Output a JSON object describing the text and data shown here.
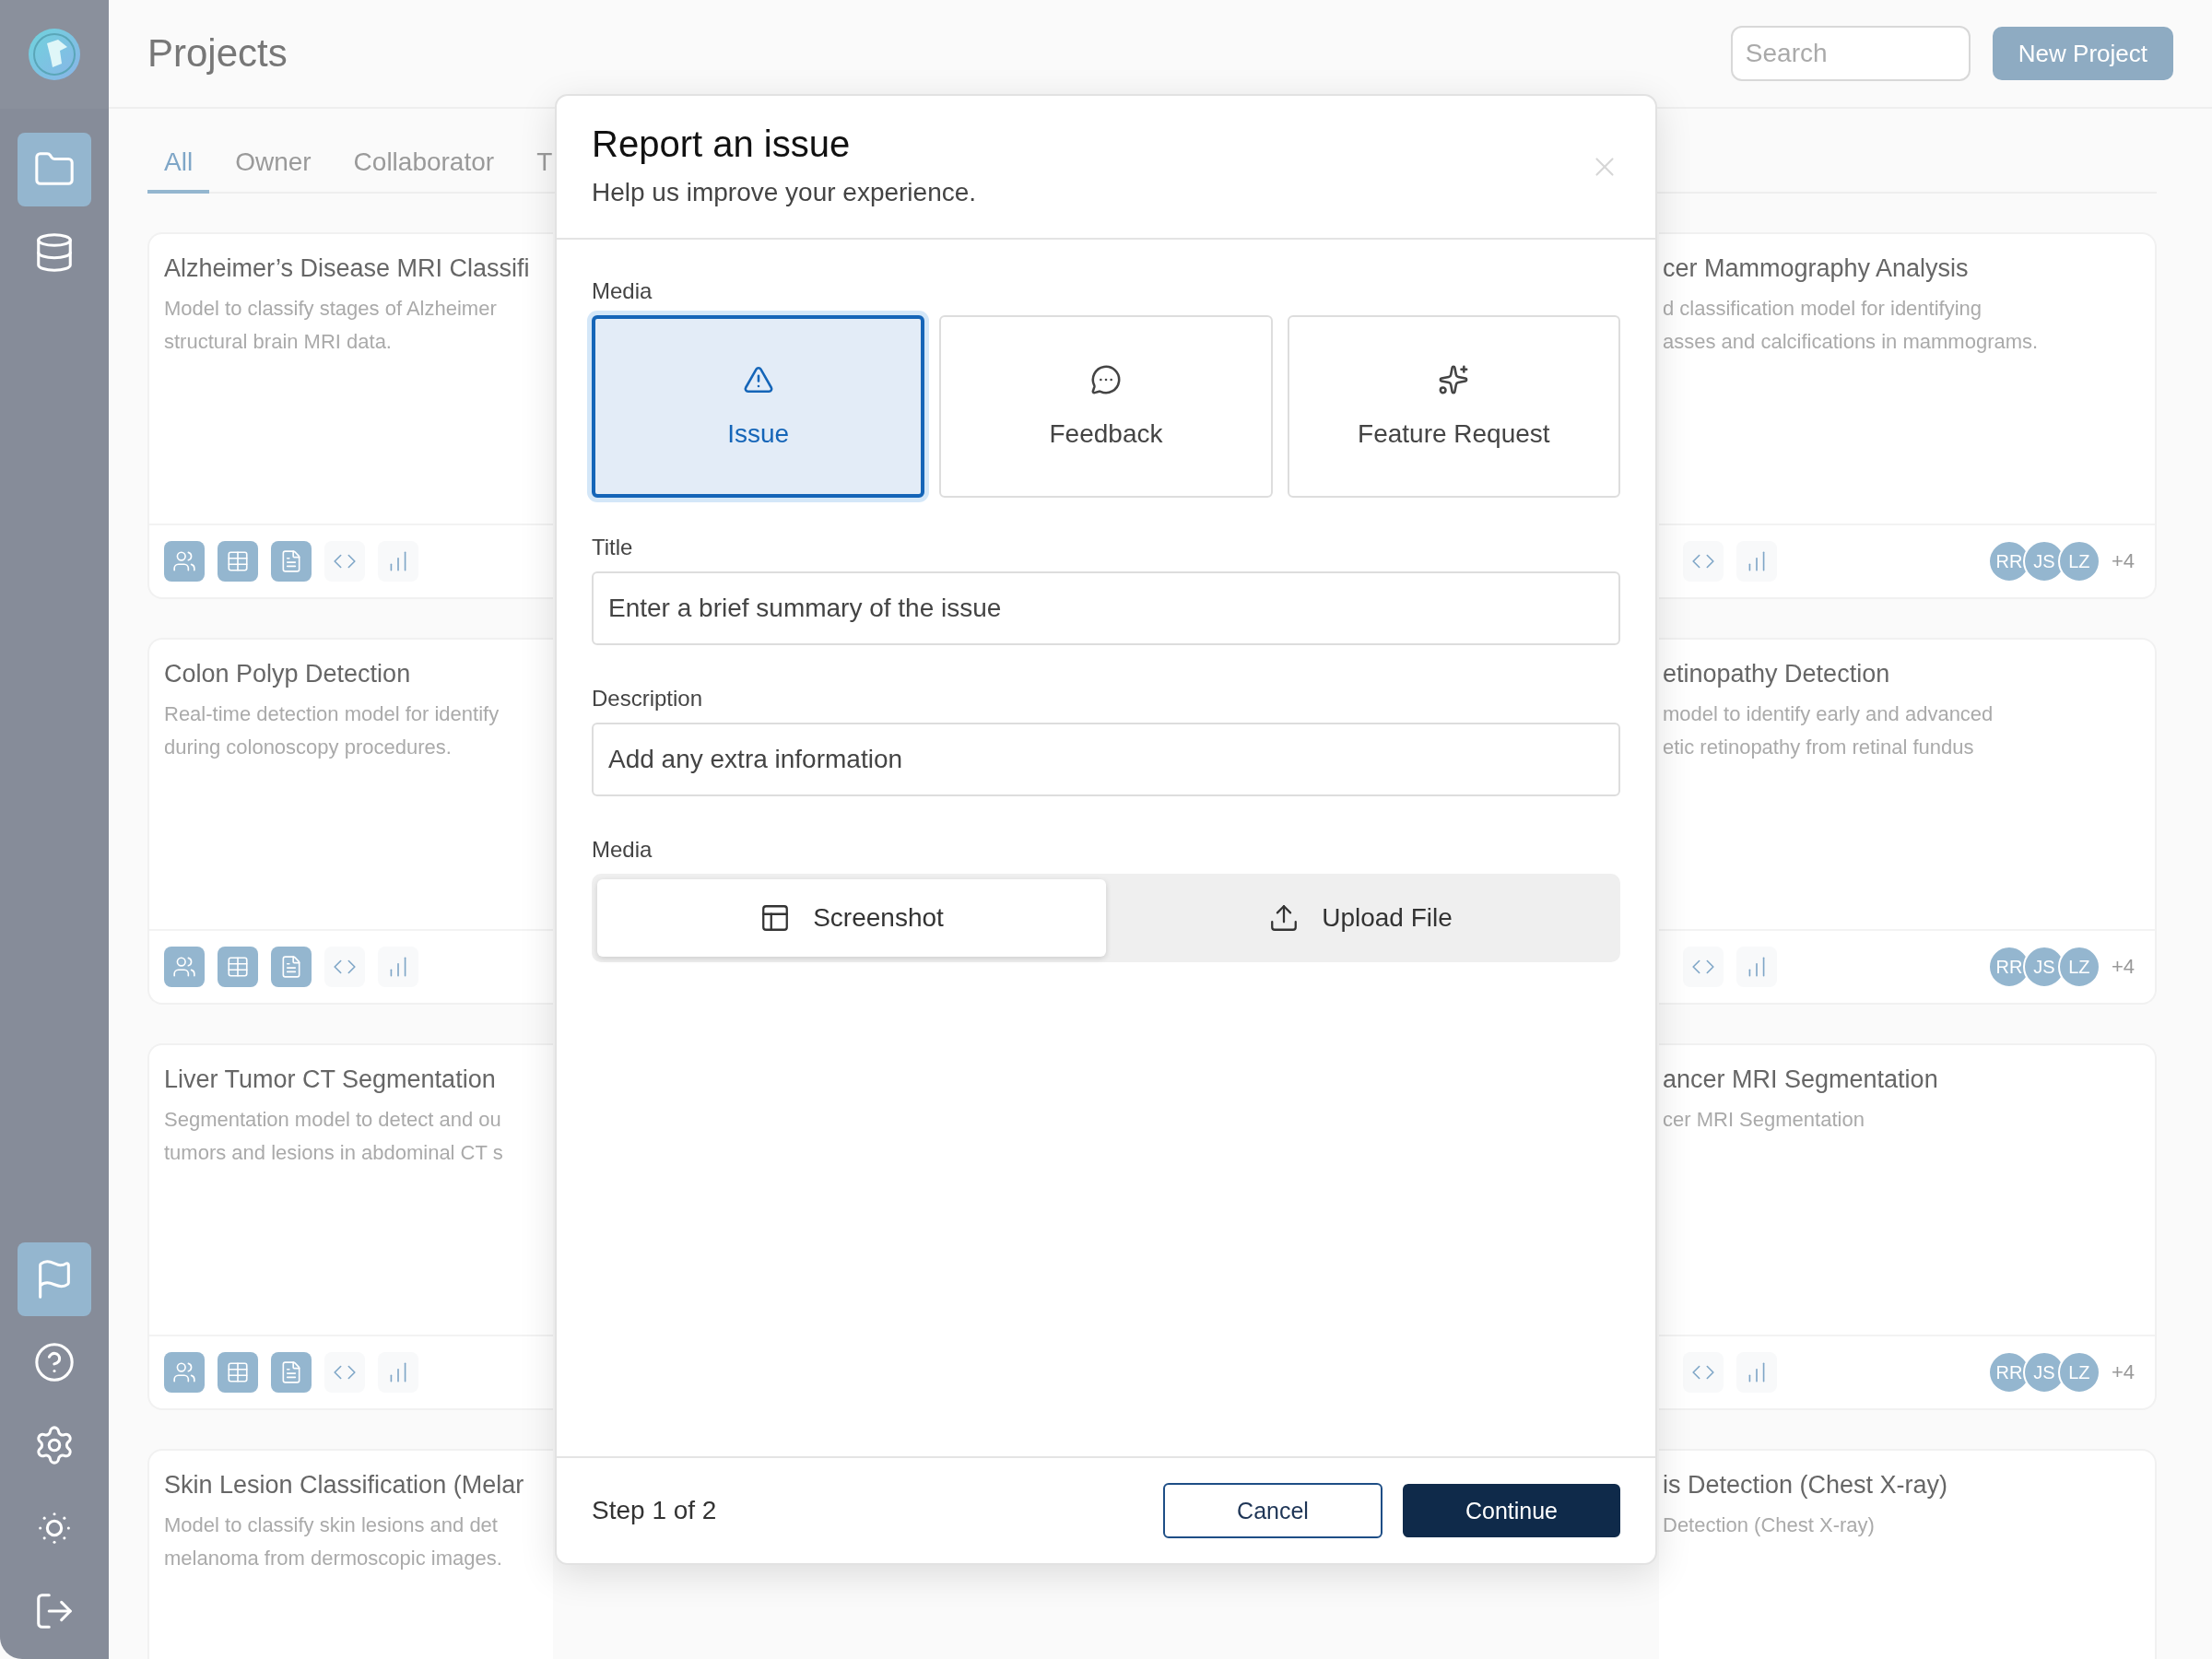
{
  "sidebar": {
    "top_items": [
      {
        "kind": "projects",
        "selected": true
      },
      {
        "kind": "data",
        "selected": false
      }
    ],
    "bottom_items": [
      {
        "kind": "report",
        "selected": true
      },
      {
        "kind": "help",
        "selected": false
      },
      {
        "kind": "settings",
        "selected": false
      },
      {
        "kind": "theme",
        "selected": false
      },
      {
        "kind": "logout",
        "selected": false
      }
    ]
  },
  "header": {
    "title": "Projects",
    "search": {
      "placeholder": "Search"
    },
    "new_button": "New Project"
  },
  "tabs": [
    {
      "label": "All",
      "selected": true
    },
    {
      "label": "Owner",
      "selected": false
    },
    {
      "label": "Collaborator",
      "selected": false
    },
    {
      "label": "T",
      "selected": false
    }
  ],
  "card_rows": [
    {
      "left": {
        "title": "Alzheimer’s Disease MRI Classifi",
        "description_lines": [
          "Model to classify stages of Alzheimer",
          "structural brain MRI data."
        ],
        "tools": [
          {
            "kind": "people",
            "active": true
          },
          {
            "kind": "table",
            "active": true
          },
          {
            "kind": "document",
            "active": true
          },
          {
            "kind": "code",
            "active": false
          },
          {
            "kind": "chart",
            "active": false
          }
        ]
      },
      "right": {
        "title": "cer Mammography Analysis",
        "description_lines": [
          "d classification model for identifying",
          "asses and calcifications in mammograms."
        ],
        "tools": [
          {
            "kind": "code",
            "active": false
          },
          {
            "kind": "chart",
            "active": false
          }
        ],
        "avatars": [
          "RR",
          "JS",
          "LZ"
        ],
        "more": "+4"
      }
    },
    {
      "left": {
        "title": "Colon Polyp Detection",
        "description_lines": [
          "Real-time detection model for identify",
          "during colonoscopy procedures."
        ],
        "tools": [
          {
            "kind": "people",
            "active": true
          },
          {
            "kind": "table",
            "active": true
          },
          {
            "kind": "document",
            "active": true
          },
          {
            "kind": "code",
            "active": false
          },
          {
            "kind": "chart",
            "active": false
          }
        ]
      },
      "right": {
        "title": "etinopathy Detection",
        "description_lines": [
          "model to identify early and advanced",
          "etic retinopathy from retinal fundus"
        ],
        "tools": [
          {
            "kind": "code",
            "active": false
          },
          {
            "kind": "chart",
            "active": false
          }
        ],
        "avatars": [
          "RR",
          "JS",
          "LZ"
        ],
        "more": "+4"
      }
    },
    {
      "left": {
        "title": "Liver Tumor CT Segmentation",
        "description_lines": [
          "Segmentation model to detect and ou",
          "tumors and lesions in abdominal CT s"
        ],
        "tools": [
          {
            "kind": "people",
            "active": true
          },
          {
            "kind": "table",
            "active": true
          },
          {
            "kind": "document",
            "active": true
          },
          {
            "kind": "code",
            "active": false
          },
          {
            "kind": "chart",
            "active": false
          }
        ]
      },
      "right": {
        "title": "ancer MRI Segmentation",
        "description_lines": [
          "cer MRI Segmentation"
        ],
        "tools": [
          {
            "kind": "code",
            "active": false
          },
          {
            "kind": "chart",
            "active": false
          }
        ],
        "avatars": [
          "RR",
          "JS",
          "LZ"
        ],
        "more": "+4"
      }
    },
    {
      "left": {
        "title": "Skin Lesion Classification (Melar",
        "description_lines": [
          "Model to classify skin lesions and det",
          "melanoma from dermoscopic images."
        ]
      },
      "right": {
        "title": "is Detection (Chest X-ray)",
        "description_lines": [
          "Detection (Chest X-ray)"
        ]
      }
    }
  ],
  "dialog": {
    "title": "Report an issue",
    "subtitle": "Help us improve your experience.",
    "type_label": "Media",
    "types": [
      {
        "kind": "issue",
        "label": "Issue",
        "selected": true
      },
      {
        "kind": "feedback",
        "label": "Feedback",
        "selected": false
      },
      {
        "kind": "feature",
        "label": "Feature Request",
        "selected": false
      }
    ],
    "title_field": {
      "label": "Title",
      "placeholder": "Enter a brief summary of the issue"
    },
    "description_field": {
      "label": "Description",
      "placeholder": "Add any extra information"
    },
    "media_label": "Media",
    "media_options": [
      {
        "kind": "screenshot",
        "label": "Screenshot",
        "selected": true
      },
      {
        "kind": "upload",
        "label": "Upload File",
        "selected": false
      }
    ],
    "step": "Step 1 of 2",
    "cancel": "Cancel",
    "continue": "Continue"
  }
}
